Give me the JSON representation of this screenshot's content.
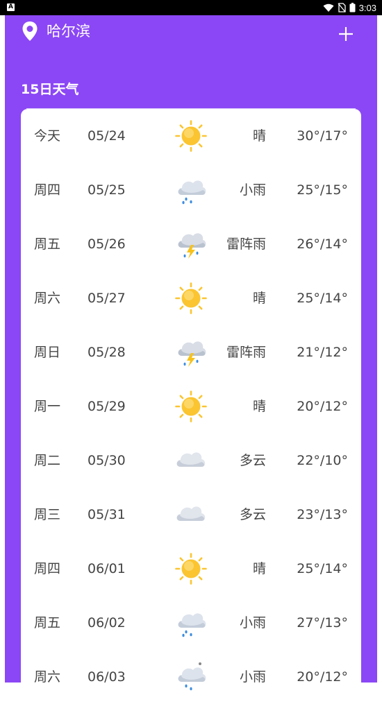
{
  "status_bar": {
    "time": "3:03",
    "badge": "A"
  },
  "header": {
    "city": "哈尔滨",
    "section_title": "15日天气"
  },
  "days": [
    {
      "day": "今天",
      "date": "05/24",
      "icon": "sun-icon",
      "condition": "晴",
      "temp": "30°/17°"
    },
    {
      "day": "周四",
      "date": "05/25",
      "icon": "light-rain-icon",
      "condition": "小雨",
      "temp": "25°/15°"
    },
    {
      "day": "周五",
      "date": "05/26",
      "icon": "thunderstorm-icon",
      "condition": "雷阵雨",
      "temp": "26°/14°"
    },
    {
      "day": "周六",
      "date": "05/27",
      "icon": "sun-icon",
      "condition": "晴",
      "temp": "25°/14°"
    },
    {
      "day": "周日",
      "date": "05/28",
      "icon": "thunderstorm-icon",
      "condition": "雷阵雨",
      "temp": "21°/12°"
    },
    {
      "day": "周一",
      "date": "05/29",
      "icon": "sun-icon",
      "condition": "晴",
      "temp": "20°/12°"
    },
    {
      "day": "周二",
      "date": "05/30",
      "icon": "cloudy-icon",
      "condition": "多云",
      "temp": "22°/10°"
    },
    {
      "day": "周三",
      "date": "05/31",
      "icon": "cloudy-icon",
      "condition": "多云",
      "temp": "23°/13°"
    },
    {
      "day": "周四",
      "date": "06/01",
      "icon": "sun-icon",
      "condition": "晴",
      "temp": "25°/14°"
    },
    {
      "day": "周五",
      "date": "06/02",
      "icon": "light-rain-icon",
      "condition": "小雨",
      "temp": "27°/13°"
    },
    {
      "day": "周六",
      "date": "06/03",
      "icon": "light-rain-icon",
      "condition": "小雨",
      "temp": "20°/12°"
    }
  ],
  "colors": {
    "header_bg": "#8b47f5",
    "text": "#444444",
    "sun": "#fbc531"
  }
}
